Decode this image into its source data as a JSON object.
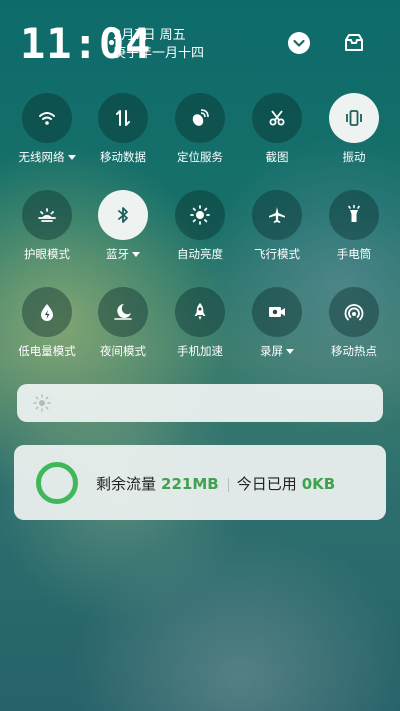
{
  "status": {
    "time": "11:04",
    "date": "2月7日 周五",
    "lunar": "庚子年一月十四"
  },
  "tiles": [
    {
      "label": "无线网络",
      "icon": "wifi-icon",
      "dropdown": true,
      "active": false
    },
    {
      "label": "移动数据",
      "icon": "mobile-data-icon",
      "dropdown": false,
      "active": false
    },
    {
      "label": "定位服务",
      "icon": "location-icon",
      "dropdown": false,
      "active": false
    },
    {
      "label": "截图",
      "icon": "scissors-icon",
      "dropdown": false,
      "active": false
    },
    {
      "label": "振动",
      "icon": "vibrate-icon",
      "dropdown": false,
      "active": true
    },
    {
      "label": "护眼模式",
      "icon": "eye-care-icon",
      "dropdown": false,
      "active": false
    },
    {
      "label": "蓝牙",
      "icon": "bluetooth-icon",
      "dropdown": true,
      "active": true
    },
    {
      "label": "自动亮度",
      "icon": "auto-brightness-icon",
      "dropdown": false,
      "active": false
    },
    {
      "label": "飞行模式",
      "icon": "airplane-icon",
      "dropdown": false,
      "active": false
    },
    {
      "label": "手电筒",
      "icon": "flashlight-icon",
      "dropdown": false,
      "active": false
    },
    {
      "label": "低电量模式",
      "icon": "low-power-icon",
      "dropdown": false,
      "active": false
    },
    {
      "label": "夜间模式",
      "icon": "night-mode-icon",
      "dropdown": false,
      "active": false
    },
    {
      "label": "手机加速",
      "icon": "rocket-icon",
      "dropdown": false,
      "active": false
    },
    {
      "label": "录屏",
      "icon": "screen-record-icon",
      "dropdown": true,
      "active": false
    },
    {
      "label": "移动热点",
      "icon": "hotspot-icon",
      "dropdown": false,
      "active": false
    }
  ],
  "brightness": {
    "icon": "sun-icon"
  },
  "data_usage": {
    "remaining_label": "剩余流量",
    "remaining_value": "221MB",
    "today_label": "今日已用",
    "today_value": "0KB"
  },
  "colors": {
    "accent": "#3fb85a",
    "tile_bg": "#0a2d2d",
    "tile_active_bg": "#eef2f1"
  }
}
